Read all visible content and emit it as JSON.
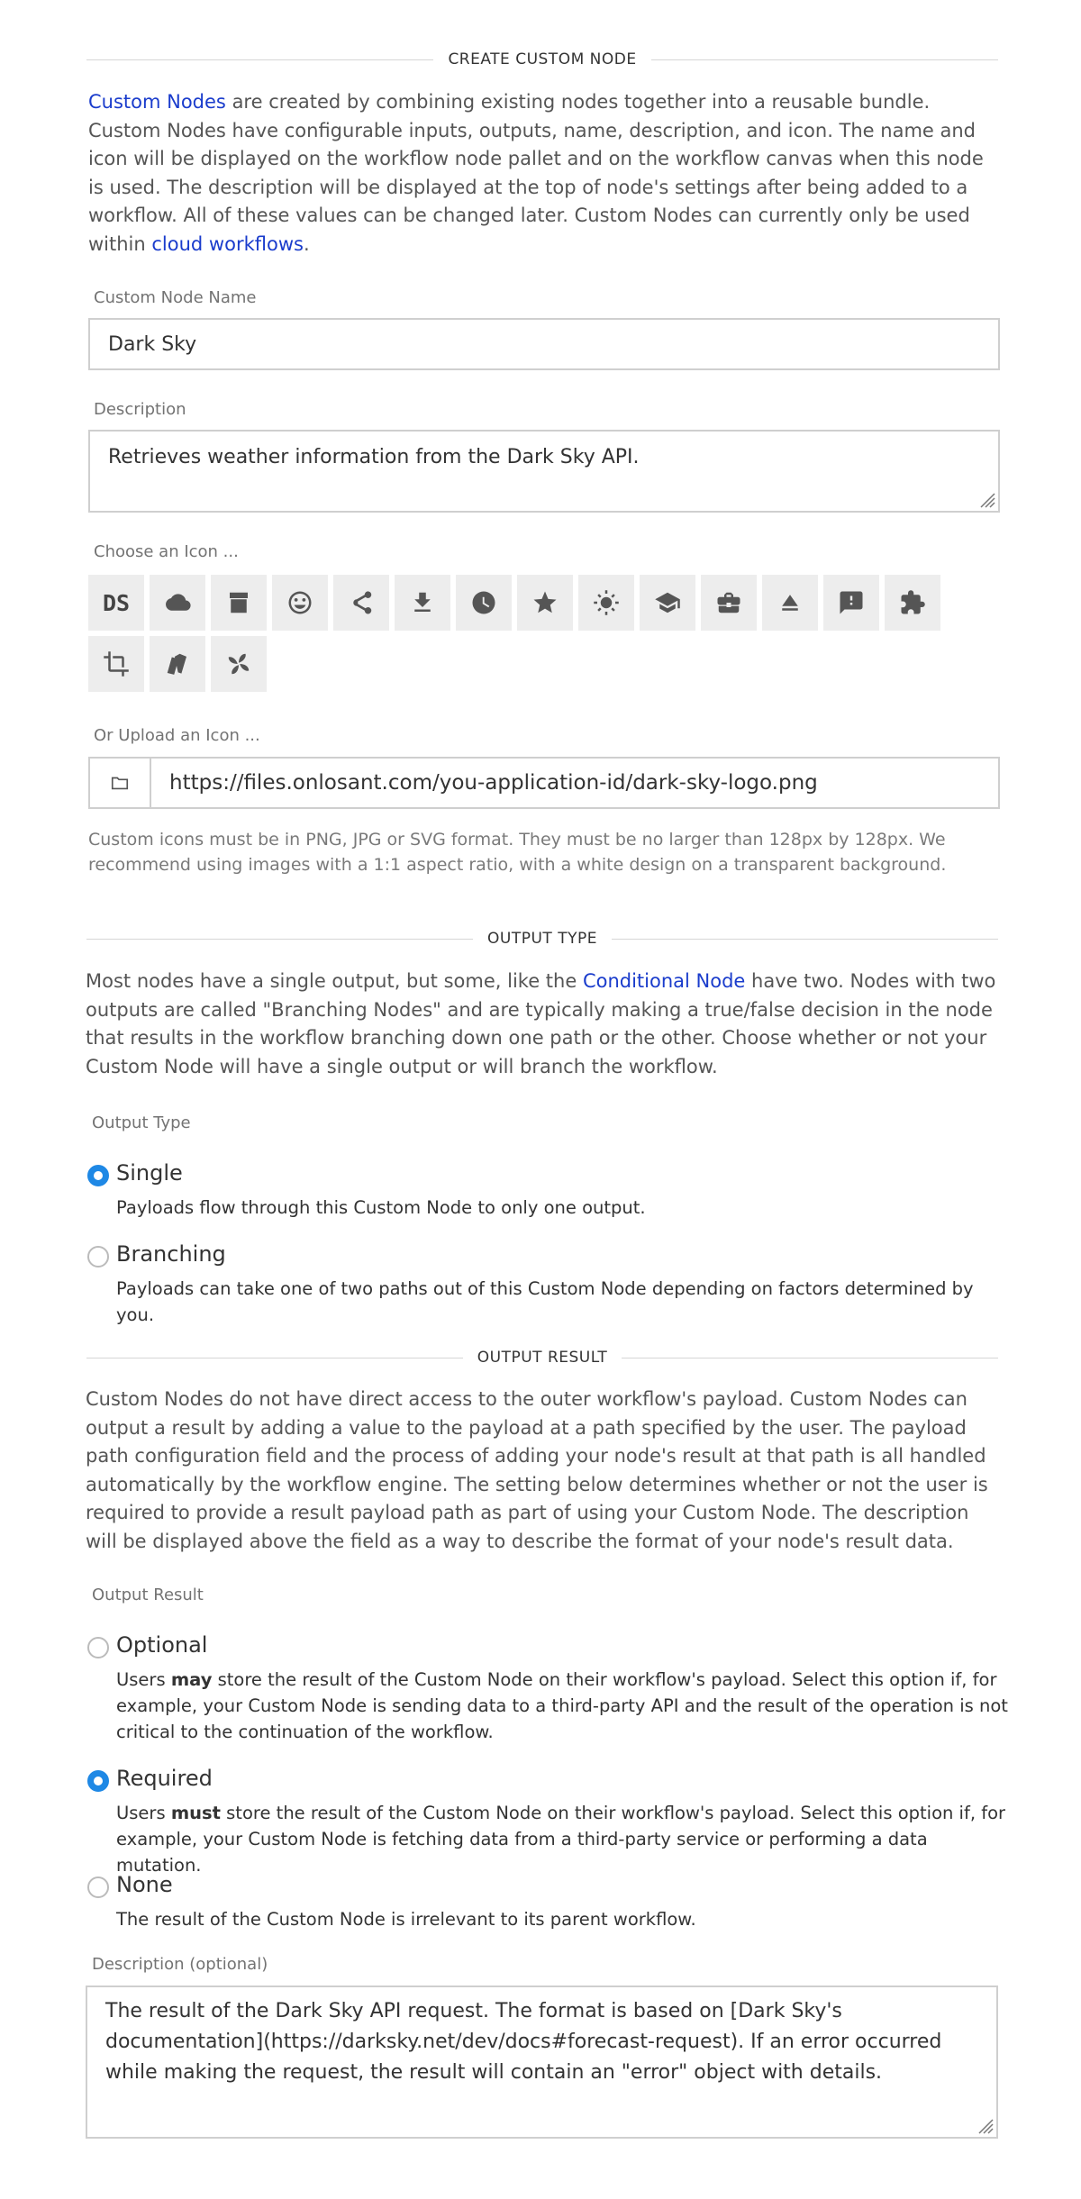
{
  "sections": {
    "create": {
      "heading": "CREATE CUSTOM NODE"
    },
    "output_type": {
      "heading": "OUTPUT TYPE"
    },
    "output_result": {
      "heading": "OUTPUT RESULT"
    }
  },
  "intro": {
    "link_custom_nodes": "Custom Nodes",
    "text": " are created by combining existing nodes together into a reusable bundle. Custom Nodes have configurable inputs, outputs, name, description, and icon. The name and icon will be displayed on the workflow node pallet and on the workflow canvas when this node is used. The description will be displayed at the top of node's settings after being added to a workflow. All of these values can be changed later. Custom Nodes can currently only be used within ",
    "link_cloud": "cloud workflows",
    "end": "."
  },
  "name_field": {
    "label": "Custom Node Name",
    "value": "Dark Sky"
  },
  "description_field": {
    "label": "Description",
    "value": "Retrieves weather information from the Dark Sky API."
  },
  "icon_picker": {
    "label": "Choose an Icon ...",
    "text_icon": "DS",
    "icons": [
      "cloud-icon",
      "archive-icon",
      "smiley-icon",
      "share-icon",
      "download-icon",
      "clock-icon",
      "star-icon",
      "sun-icon",
      "graduation-cap-icon",
      "briefcase-icon",
      "eject-icon",
      "comment-alert-icon",
      "puzzle-icon",
      "crop-icon",
      "tag-stack-icon",
      "pinwheel-icon"
    ]
  },
  "upload": {
    "label": "Or Upload an Icon ...",
    "value": "https://files.onlosant.com/you-application-id/dark-sky-logo.png",
    "help": "Custom icons must be in PNG, JPG or SVG format. They must be no larger than 128px by 128px. We recommend using images with a 1:1 aspect ratio, with a white design on a transparent background."
  },
  "output_type": {
    "intro_pre": "Most nodes have a single output, but some, like the ",
    "intro_link": "Conditional Node",
    "intro_post": " have two. Nodes with two outputs are called \"Branching Nodes\" and are typically making a true/false decision in the node that results in the workflow branching down one path or the other. Choose whether or not your Custom Node will have a single output or will branch the workflow.",
    "label": "Output Type",
    "options": [
      {
        "title": "Single",
        "desc": "Payloads flow through this Custom Node to only one output.",
        "selected": true
      },
      {
        "title": "Branching",
        "desc": "Payloads can take one of two paths out of this Custom Node depending on factors determined by you.",
        "selected": false
      }
    ]
  },
  "output_result": {
    "intro": "Custom Nodes do not have direct access to the outer workflow's payload. Custom Nodes can output a result by adding a value to the payload at a path specified by the user. The payload path configuration field and the process of adding your node's result at that path is all handled automatically by the workflow engine. The setting below determines whether or not the user is required to provide a result payload path as part of using your Custom Node. The description will be displayed above the field as a way to describe the format of your node's result data.",
    "label": "Output Result",
    "options": [
      {
        "title": "Optional",
        "desc_pre": "Users ",
        "desc_bold": "may",
        "desc_post": " store the result of the Custom Node on their workflow's payload. Select this option if, for example, your Custom Node is sending data to a third-party API and the result of the operation is not critical to the continuation of the workflow.",
        "selected": false
      },
      {
        "title": "Required",
        "desc_pre": "Users ",
        "desc_bold": "must",
        "desc_post": " store the result of the Custom Node on their workflow's payload. Select this option if, for example, your Custom Node is fetching data from a third-party service or performing a data mutation.",
        "selected": true
      },
      {
        "title": "None",
        "desc_pre": "The result of the Custom Node is irrelevant to its parent workflow.",
        "desc_bold": "",
        "desc_post": "",
        "selected": false
      }
    ],
    "description_label": "Description (optional)",
    "description_value": "The result of the Dark Sky API request. The format is based on [Dark Sky's documentation](https://darksky.net/dev/docs#forecast-request). If an error occurred while making the request, the result will contain an \"error\" object with details."
  },
  "colors": {
    "link": "#1a3ccc",
    "radio_selected": "#1e88e5",
    "border": "#cfcfcf",
    "tile": "#ededed"
  }
}
